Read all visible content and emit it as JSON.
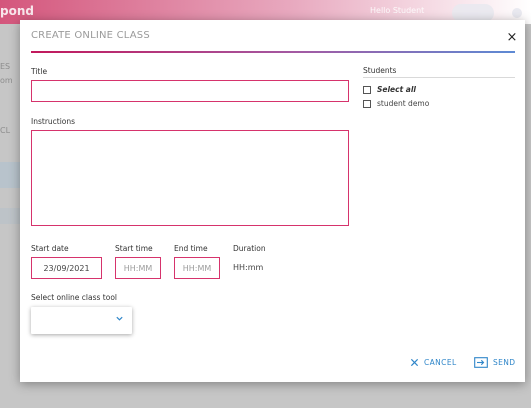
{
  "background": {
    "brand_label": "pond",
    "user_label": "Hello Student",
    "left_label_a": "ES",
    "left_label_b": "om",
    "left_label_c": "CL"
  },
  "modal": {
    "title": "CREATE ONLINE CLASS",
    "close_label": "×"
  },
  "form": {
    "title_label": "Title",
    "title_value": "",
    "instructions_label": "Instructions",
    "instructions_value": "",
    "start_date_label": "Start date",
    "start_date_value": "23/09/2021",
    "start_time_label": "Start time",
    "start_time_placeholder": "HH:MM",
    "end_time_label": "End time",
    "end_time_placeholder": "HH:MM",
    "duration_label": "Duration",
    "duration_value": "HH:mm",
    "tool_label": "Select online class tool",
    "tool_value": ""
  },
  "students": {
    "title": "Students",
    "items": [
      {
        "label": "Select all",
        "checked": false
      },
      {
        "label": "student demo",
        "checked": false
      }
    ]
  },
  "actions": {
    "cancel_label": "CANCEL",
    "send_label": "SEND"
  },
  "colors": {
    "accent": "#d6336c",
    "link": "#2f86c9"
  },
  "icons": {
    "close": "close-icon",
    "chevron": "chevron-down-icon",
    "cancel": "x-icon",
    "send": "send-icon"
  }
}
